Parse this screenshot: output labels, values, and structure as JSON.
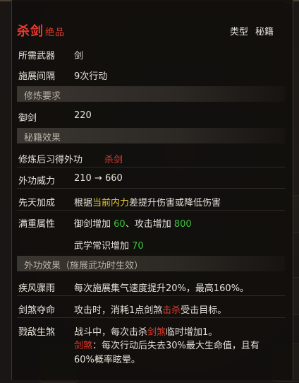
{
  "header": {
    "name": "杀剑",
    "grade": "绝品",
    "type_label": "类型",
    "type_value": "秘籍"
  },
  "basic": [
    {
      "label": "所需武器",
      "value": "剑"
    },
    {
      "label": "施展间隔",
      "value": "9次行动"
    }
  ],
  "req_section": "修炼要求",
  "requirement": {
    "label": "御剑",
    "value": "220"
  },
  "effect_section": "秘籍效果",
  "learn": {
    "label": "修炼后习得外功",
    "value": "杀剑"
  },
  "power": {
    "label": "外功威力",
    "value": "210 → 660"
  },
  "innate": {
    "label": "先天加成",
    "pre": "根据",
    "highlight": "当前内力",
    "post": "差提升伤害或降低伤害"
  },
  "full": {
    "label": "满重属性",
    "line1_a": "御剑增加 ",
    "line1_b": "60",
    "line1_c": "、攻击增加 ",
    "line1_d": "800",
    "line2_a": "武学常识增加 ",
    "line2_b": "70"
  },
  "ext_section": "外功效果（施展武功时生效）",
  "ext": [
    {
      "label": "疾风骤雨",
      "text": "每次施展集气速度提升20%，最高160%。"
    },
    {
      "label": "剑煞夺命",
      "pre": "攻击时，消耗1点剑煞",
      "highlight": "击杀",
      "post": "受击目标。"
    },
    {
      "label": "戮敌生煞",
      "pre": "战斗中，每次击杀",
      "highlight": "剑煞",
      "post": "临时增加1。",
      "note_key": "剑煞",
      "note_line1": "：每次行动后失去30%最大生命值，且有",
      "note_line2": "60%概率眩晕。"
    }
  ],
  "colors": {
    "accent_red": "#e23a2c",
    "green": "#3fc23f",
    "yellow": "#e5c43a",
    "text": "#e6e2da",
    "section": "#b8b1a6"
  }
}
